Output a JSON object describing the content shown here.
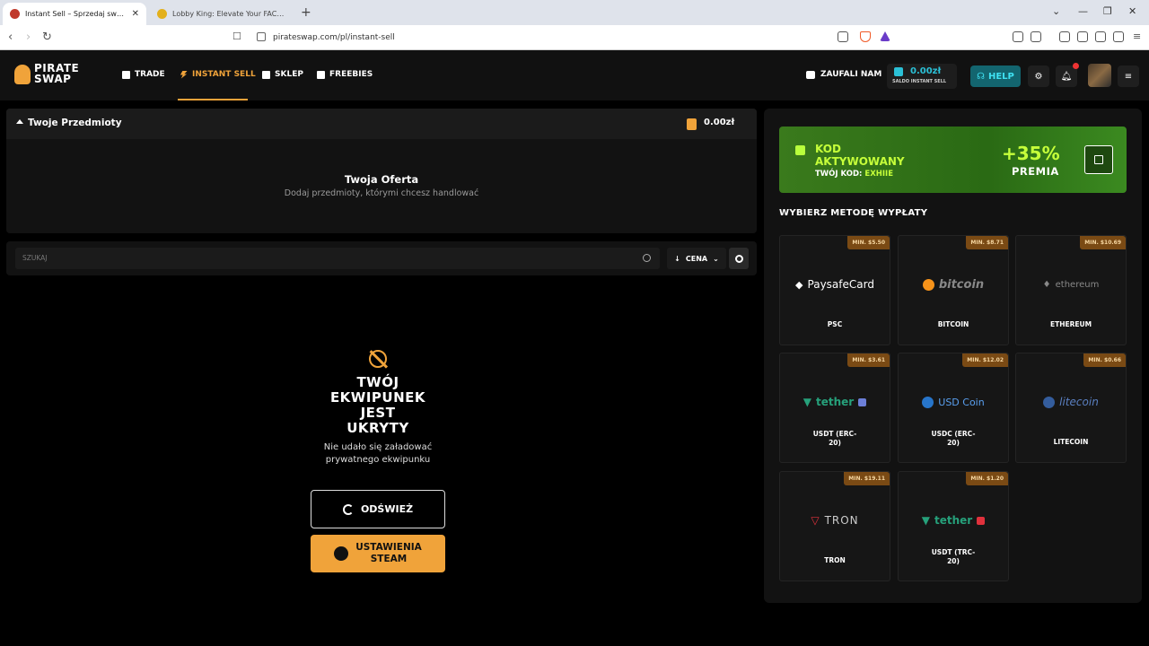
{
  "browser": {
    "tabs": [
      {
        "title": "Instant Sell – Sprzedaj swoje sk",
        "active": true
      },
      {
        "title": "Lobby King: Elevate Your FACEIT Elo",
        "active": false
      }
    ],
    "url": "pirateswap.com/pl/instant-sell"
  },
  "header": {
    "logo_top": "PIRATE",
    "logo_bottom": "SWAP",
    "nav": [
      {
        "label": "TRADE",
        "icon": "trade-icon"
      },
      {
        "label": "INSTANT SELL",
        "icon": "lightning-icon",
        "active": true
      },
      {
        "label": "SKLEP",
        "icon": "shop-icon"
      },
      {
        "label": "FREEBIES",
        "icon": "gift-icon"
      }
    ],
    "trust_label": "ZAUFALI NAM",
    "balance_amount": "0.00zł",
    "balance_label": "SALDO INSTANT SELL",
    "help_label": "HELP",
    "accent_color": "#f0a33a",
    "help_color": "#3fe1f2"
  },
  "items_panel": {
    "title": "Twoje Przedmioty",
    "value": "0.00zł",
    "offer_title": "Twoja Oferta",
    "offer_subtitle": "Dodaj przedmioty, którymi chcesz handlować"
  },
  "search": {
    "placeholder": "SZUKAJ",
    "sort_label": "CENA"
  },
  "inventory_hidden": {
    "title_line1": "TWÓJ",
    "title_line2": "EKWIPUNEK",
    "title_line3": "JEST",
    "title_line4": "UKRYTY",
    "subtitle_line1": "Nie udało się załadować",
    "subtitle_line2": "prywatnego ekwipunku",
    "refresh_label": "ODŚWIEŻ",
    "steam_label_line1": "USTAWIENIA",
    "steam_label_line2": "STEAM"
  },
  "promo": {
    "line1": "KOD",
    "line2": "AKTYWOWANY",
    "code_prefix": "TWÓJ KOD:",
    "code": "EXHIIE",
    "bonus": "+35%",
    "bonus_label": "PREMIA",
    "color": "#c6ff3a"
  },
  "withdraw": {
    "title": "WYBIERZ METODĘ WYPŁATY",
    "methods": [
      {
        "min": "MIN. $5.50",
        "logo": "PaysafeCard",
        "name": "PSC"
      },
      {
        "min": "MIN. $8.71",
        "logo": "bitcoin",
        "name": "BITCOIN"
      },
      {
        "min": "MIN. $10.69",
        "logo": "ethereum",
        "name": "ETHEREUM"
      },
      {
        "min": "MIN. $3.61",
        "logo": "tether",
        "name_line1": "USDT (ERC-",
        "name_line2": "20)"
      },
      {
        "min": "MIN. $12.02",
        "logo": "USD Coin",
        "name_line1": "USDC (ERC-",
        "name_line2": "20)"
      },
      {
        "min": "MIN. $0.66",
        "logo": "litecoin",
        "name": "LITECOIN"
      },
      {
        "min": "MIN. $19.11",
        "logo": "TRON",
        "name": "TRON"
      },
      {
        "min": "MIN. $1.20",
        "logo": "tether",
        "name_line1": "USDT (TRC-",
        "name_line2": "20)"
      }
    ]
  }
}
